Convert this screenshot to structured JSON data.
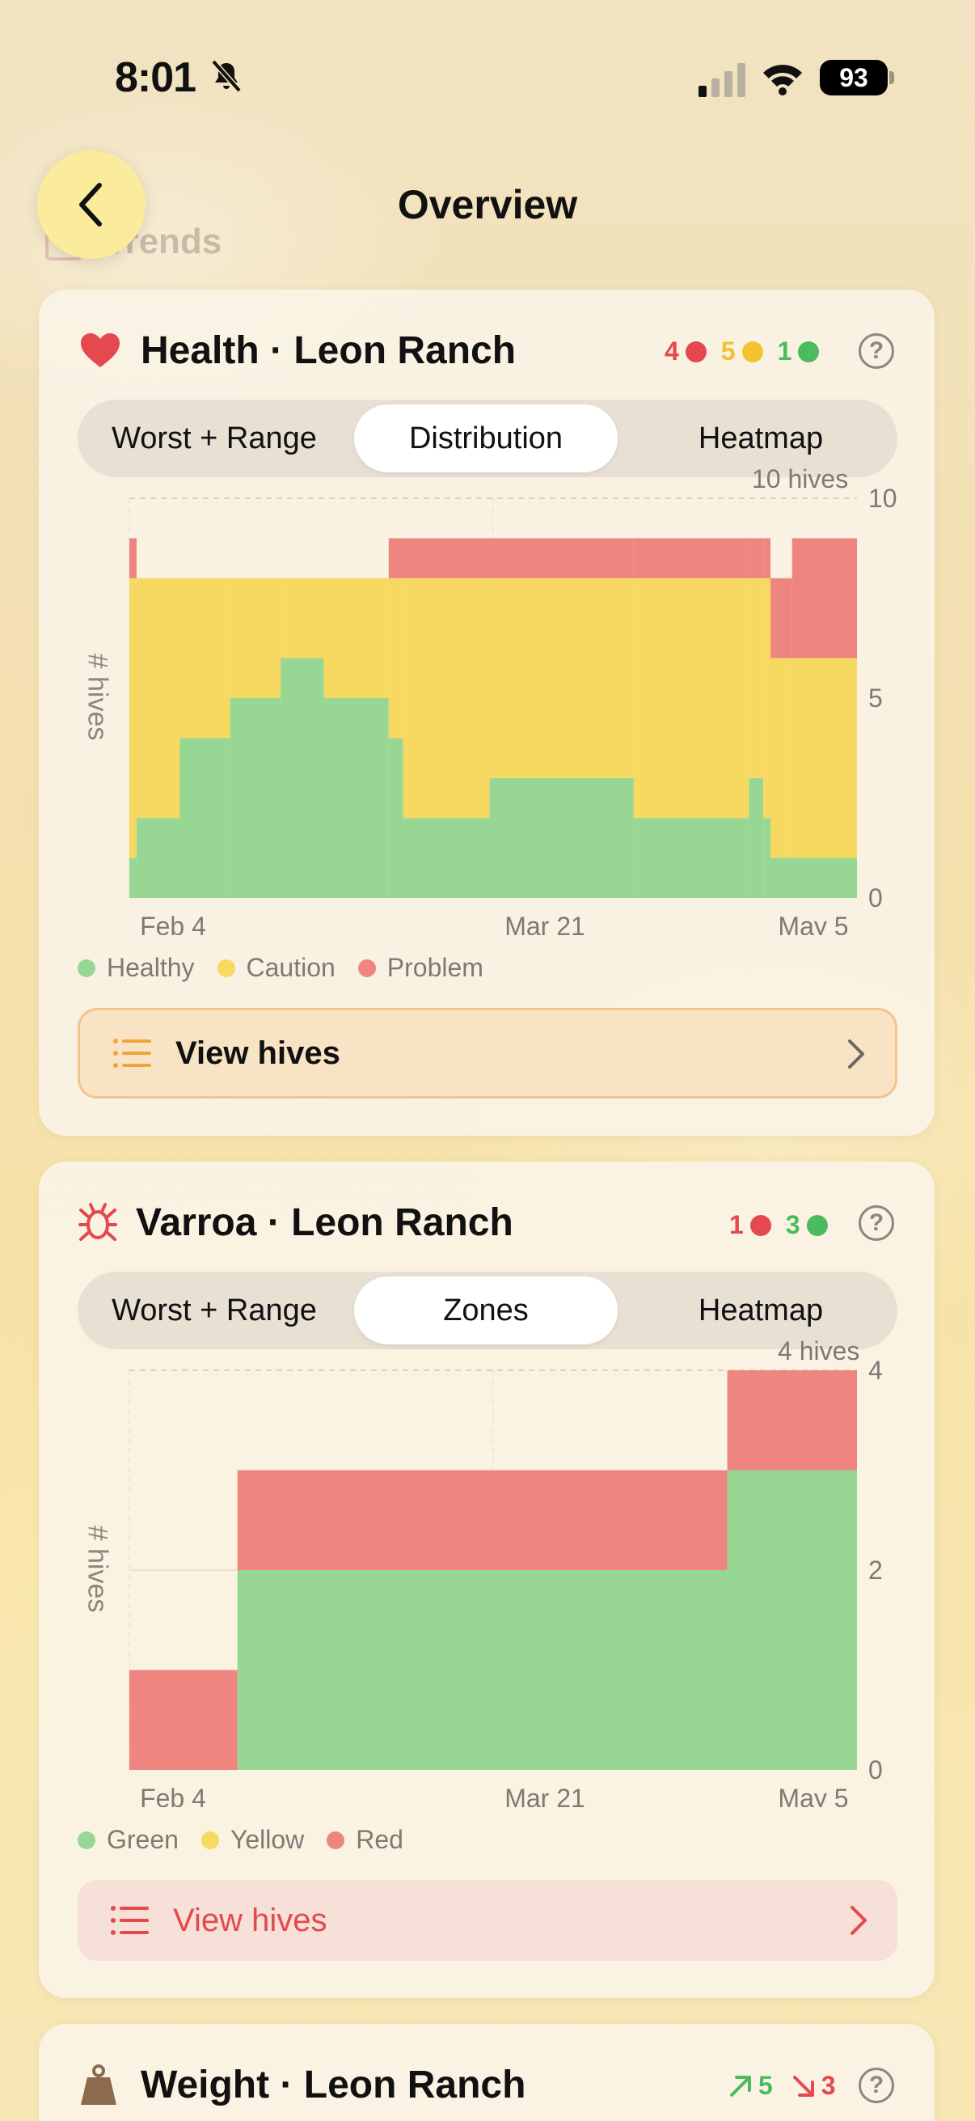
{
  "status_bar": {
    "time": "8:01",
    "battery": "93"
  },
  "nav": {
    "title": "Overview",
    "behind_text": "Trends"
  },
  "health_card": {
    "title": "Health · Leon Ranch",
    "badges": [
      {
        "count": "4",
        "color": "#e5484d"
      },
      {
        "count": "5",
        "color": "#f4c430"
      },
      {
        "count": "1",
        "color": "#4cbb5f"
      }
    ],
    "tabs": [
      "Worst + Range",
      "Distribution",
      "Heatmap"
    ],
    "active_tab": "Distribution",
    "total_label": "10 hives",
    "y_axis_title": "# hives",
    "legend": [
      "Healthy",
      "Caution",
      "Problem"
    ],
    "button_label": "View hives"
  },
  "varroa_card": {
    "title": "Varroa · Leon Ranch",
    "badges": [
      {
        "count": "1",
        "color": "#e5484d"
      },
      {
        "count": "3",
        "color": "#4cbb5f"
      }
    ],
    "tabs": [
      "Worst + Range",
      "Zones",
      "Heatmap"
    ],
    "active_tab": "Zones",
    "total_label": "4 hives",
    "y_axis_title": "# hives",
    "legend": [
      "Green",
      "Yellow",
      "Red"
    ],
    "button_label": "View hives"
  },
  "weight_card": {
    "title": "Weight · Leon Ranch",
    "up_count": "5",
    "down_count": "3"
  },
  "colors": {
    "healthy": "#97d693",
    "caution": "#f7d861",
    "problem": "#ee8580",
    "accent_orange": "#f2a33a",
    "accent_red": "#e5484d"
  },
  "chart_data": [
    {
      "type": "area",
      "title": "Health · Leon Ranch",
      "ylabel": "# hives",
      "xlabel": "",
      "x_tick_labels": [
        "Feb 4",
        "Mar 21",
        "May 5"
      ],
      "ylim": [
        0,
        10
      ],
      "y_ticks": [
        0,
        5,
        10
      ],
      "stacked": true,
      "step": true,
      "x": [
        "Jan 29",
        "Jan 30",
        "Feb 5",
        "Feb 12",
        "Feb 19",
        "Feb 25",
        "Mar 6",
        "Mar 8",
        "Mar 20",
        "Apr 9",
        "Apr 25",
        "Apr 27",
        "Apr 28",
        "May 1",
        "May 10"
      ],
      "series": [
        {
          "name": "Healthy",
          "values": [
            1,
            2,
            4,
            5,
            6,
            5,
            4,
            2,
            3,
            2,
            3,
            2,
            1,
            1,
            1
          ]
        },
        {
          "name": "Caution",
          "values": [
            7,
            6,
            4,
            3,
            2,
            3,
            4,
            6,
            5,
            6,
            5,
            6,
            5,
            5,
            5
          ]
        },
        {
          "name": "Problem",
          "values": [
            1,
            0,
            0,
            0,
            0,
            0,
            1,
            1,
            1,
            1,
            1,
            1,
            2,
            3,
            4
          ]
        }
      ]
    },
    {
      "type": "area",
      "title": "Varroa · Leon Ranch",
      "ylabel": "# hives",
      "xlabel": "",
      "x_tick_labels": [
        "Feb 4",
        "Mar 21",
        "May 5"
      ],
      "ylim": [
        0,
        4
      ],
      "y_ticks": [
        0,
        2,
        4
      ],
      "stacked": true,
      "step": true,
      "x": [
        "Jan 29",
        "Feb 13",
        "Apr 22"
      ],
      "series": [
        {
          "name": "Green",
          "values": [
            0,
            2,
            3
          ]
        },
        {
          "name": "Yellow",
          "values": [
            0,
            0,
            0
          ]
        },
        {
          "name": "Red",
          "values": [
            1,
            1,
            1
          ]
        }
      ]
    }
  ]
}
